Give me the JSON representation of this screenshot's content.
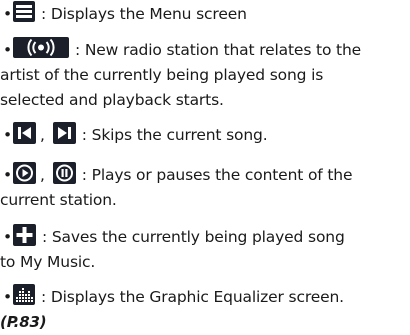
{
  "items": [
    {
      "bullet": "•",
      "icon": "menu-icon",
      "text": ": Displays the Menu screen"
    },
    {
      "bullet": "•",
      "icon": "radio-broadcast-icon",
      "text": ": New radio station that relates to the",
      "text2": "artist of the currently being played song is",
      "text3": "selected and playback starts."
    },
    {
      "bullet": "•",
      "icons": [
        "skip-back-icon",
        "skip-forward-icon"
      ],
      "sep": ",",
      "text": ": Skips the current song."
    },
    {
      "bullet": "•",
      "icons": [
        "play-icon",
        "pause-icon"
      ],
      "sep": ",",
      "text": ": Plays or pauses the content of the",
      "text2": "current station."
    },
    {
      "bullet": "•",
      "icon": "plus-icon",
      "text": ": Saves the currently being played song",
      "text2": "to My Music."
    },
    {
      "bullet": "•",
      "icon": "equalizer-icon",
      "text": ": Displays the Graphic Equalizer screen.",
      "ref": "(P.83)"
    }
  ]
}
